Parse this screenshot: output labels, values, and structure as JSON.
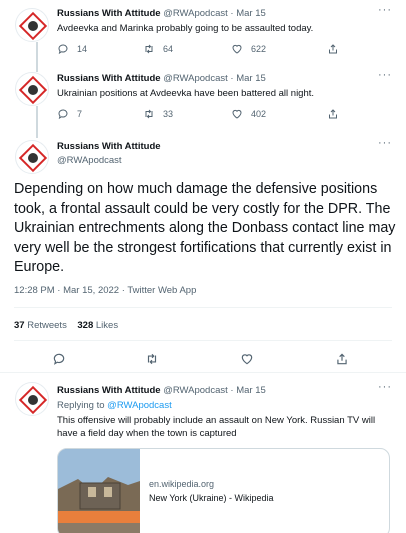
{
  "tweets": [
    {
      "name": "Russians With Attitude",
      "handle": "@RWApodcast",
      "time": "Mar 15",
      "text": "Avdeevka and Marinka probably going to be assaulted today.",
      "replies": "14",
      "retweets": "64",
      "likes": "622"
    },
    {
      "name": "Russians With Attitude",
      "handle": "@RWApodcast",
      "time": "Mar 15",
      "text": "Ukrainian positions at Avdeevka have been battered all night.",
      "replies": "7",
      "retweets": "33",
      "likes": "402"
    }
  ],
  "main_tweet": {
    "name": "Russians With Attitude",
    "handle": "@RWApodcast",
    "text": "Depending on how much damage the defensive positions took, a frontal assault could be very costly for the DPR. The Ukrainian entrechments along the Donbass contact line may very well be the strongest fortifications that currently exist in Europe.",
    "meta": "12:28 PM · Mar 15, 2022 · Twitter Web App",
    "retweets_count": "37",
    "retweets_label": "Retweets",
    "likes_count": "328",
    "likes_label": "Likes"
  },
  "reply_tweet": {
    "name": "Russians With Attitude",
    "handle": "@RWApodcast",
    "time": "Mar 15",
    "replying_prefix": "Replying to",
    "replying_handle": "@RWApodcast",
    "text": "This offensive will probably include an assault on New York. Russian TV will have a field day when the town is captured",
    "card_domain": "en.wikipedia.org",
    "card_title": "New York (Ukraine) - Wikipedia"
  },
  "more_label": "···",
  "dot": "·",
  "colors": {
    "text": "#0f1419",
    "muted": "#536471",
    "link": "#1d9bf0",
    "line": "#cfd9de"
  }
}
